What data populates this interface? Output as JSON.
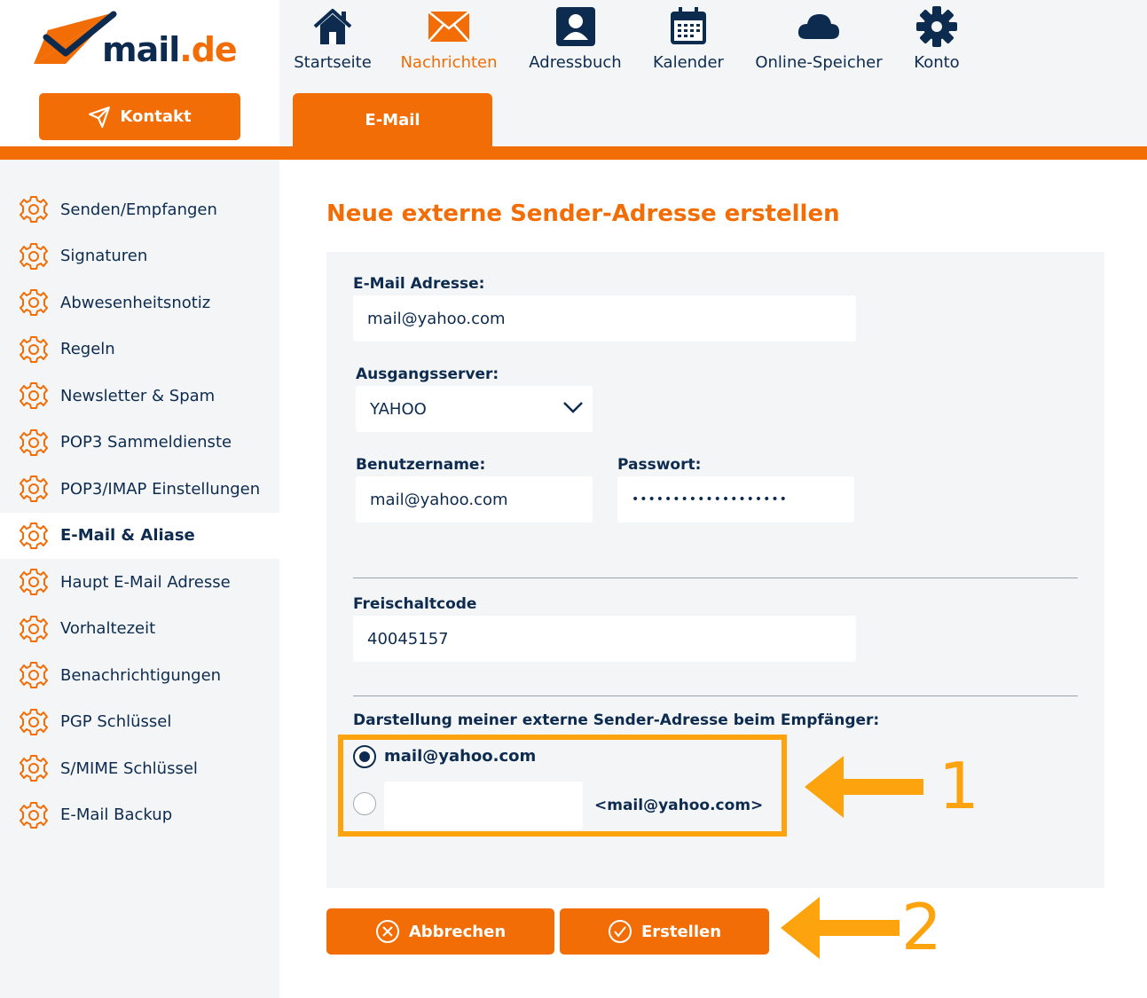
{
  "brand": {
    "name_main": "mail",
    "name_tld": ".de",
    "accent": "#f26d05",
    "navy": "#0d2b4f"
  },
  "contact_button": {
    "label": "Kontakt",
    "icon": "send-icon"
  },
  "top_nav": [
    {
      "label": "Startseite",
      "icon": "home-icon"
    },
    {
      "label": "Nachrichten",
      "icon": "envelope-icon",
      "active": true
    },
    {
      "label": "Adressbuch",
      "icon": "contact-card-icon"
    },
    {
      "label": "Kalender",
      "icon": "calendar-icon"
    },
    {
      "label": "Online-Speicher",
      "icon": "cloud-icon"
    },
    {
      "label": "Konto",
      "icon": "gear-icon"
    }
  ],
  "tab": {
    "label": "E-Mail"
  },
  "sidebar": {
    "items": [
      {
        "label": "Senden/Empfangen"
      },
      {
        "label": "Signaturen"
      },
      {
        "label": "Abwesenheitsnotiz"
      },
      {
        "label": "Regeln"
      },
      {
        "label": "Newsletter & Spam"
      },
      {
        "label": "POP3 Sammeldienste"
      },
      {
        "label": "POP3/IMAP Einstellungen"
      },
      {
        "label": "E-Mail & Aliase",
        "active": true
      },
      {
        "label": "Haupt E-Mail Adresse"
      },
      {
        "label": "Vorhaltezeit"
      },
      {
        "label": "Benachrichtigungen"
      },
      {
        "label": "PGP Schlüssel"
      },
      {
        "label": "S/MIME Schlüssel"
      },
      {
        "label": "E-Mail Backup"
      }
    ]
  },
  "main": {
    "title": "Neue externe Sender-Adresse erstellen",
    "email": {
      "label": "E-Mail Adresse:",
      "value": "mail@yahoo.com"
    },
    "server": {
      "label": "Ausgangsserver:",
      "value": "YAHOO"
    },
    "username": {
      "label": "Benutzername:",
      "value": "mail@yahoo.com"
    },
    "password": {
      "label": "Passwort:",
      "value": "•••••••••••••••••••"
    },
    "code": {
      "label": "Freischaltcode",
      "value": "40045157"
    },
    "display": {
      "label": "Darstellung meiner externe Sender-Adresse beim Empfänger:",
      "option1": "mail@yahoo.com",
      "option2_name": "",
      "option2_suffix": "<mail@yahoo.com>",
      "selected": 1
    },
    "cancel_label": "Abbrechen",
    "create_label": "Erstellen"
  },
  "annotations": {
    "arrow1": "1",
    "arrow2": "2",
    "color": "#fda30e"
  }
}
